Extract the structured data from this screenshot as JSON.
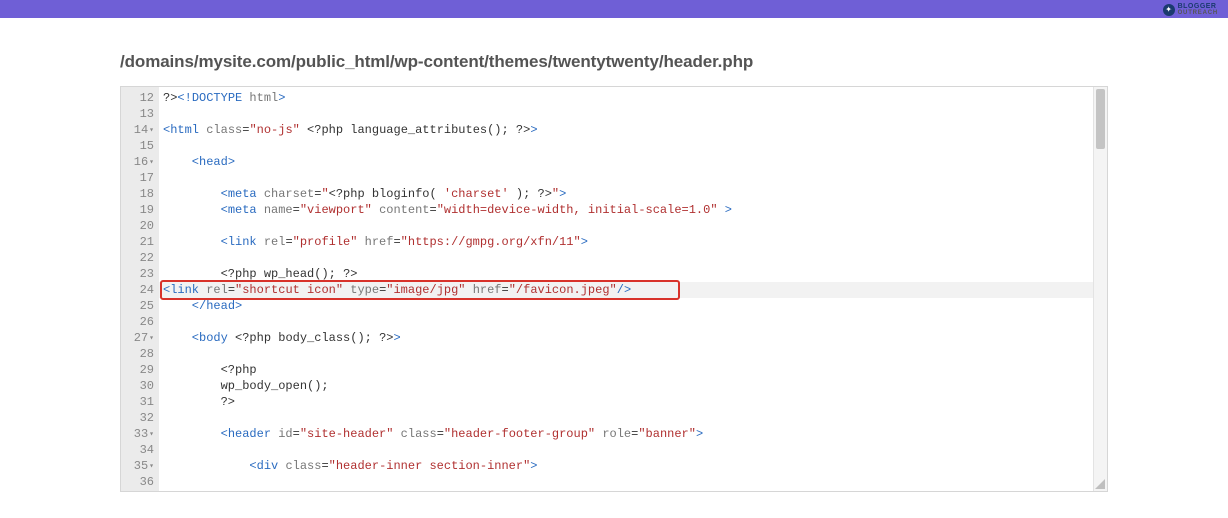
{
  "branding": {
    "line1": "BLOGGER",
    "line2": "OUTREACH",
    "badge": "✦"
  },
  "filepath": "/domains/mysite.com/public_html/wp-content/themes/twentytwenty/header.php",
  "gutter": [
    {
      "n": "12",
      "fold": false
    },
    {
      "n": "13",
      "fold": false
    },
    {
      "n": "14",
      "fold": true
    },
    {
      "n": "15",
      "fold": false
    },
    {
      "n": "16",
      "fold": true
    },
    {
      "n": "17",
      "fold": false
    },
    {
      "n": "18",
      "fold": false
    },
    {
      "n": "19",
      "fold": false
    },
    {
      "n": "20",
      "fold": false
    },
    {
      "n": "21",
      "fold": false
    },
    {
      "n": "22",
      "fold": false
    },
    {
      "n": "23",
      "fold": false
    },
    {
      "n": "24",
      "fold": false
    },
    {
      "n": "25",
      "fold": false
    },
    {
      "n": "26",
      "fold": false
    },
    {
      "n": "27",
      "fold": true
    },
    {
      "n": "28",
      "fold": false
    },
    {
      "n": "29",
      "fold": false
    },
    {
      "n": "30",
      "fold": false
    },
    {
      "n": "31",
      "fold": false
    },
    {
      "n": "32",
      "fold": false
    },
    {
      "n": "33",
      "fold": true
    },
    {
      "n": "34",
      "fold": false
    },
    {
      "n": "35",
      "fold": true
    },
    {
      "n": "36",
      "fold": false
    }
  ],
  "code": {
    "l12": {
      "a": "?>",
      "b": "<!",
      "c": "DOCTYPE ",
      "d": "html",
      "e": ">"
    },
    "l14": {
      "a": "<",
      "b": "html ",
      "c": "class",
      "d": "=",
      "e": "\"no-js\"",
      "f": " <?php ",
      "g": "language_attributes",
      "h": "(); ",
      "i": "?>",
      "j": ">"
    },
    "l16": {
      "a": "    <",
      "b": "head",
      "c": ">"
    },
    "l18": {
      "a": "        <",
      "b": "meta ",
      "c": "charset",
      "d": "=",
      "e": "\"",
      "f": "<?php ",
      "g": "bloginfo",
      "h": "( ",
      "i": "'charset'",
      "j": " ); ",
      "k": "?>",
      "l": "\"",
      "m": ">"
    },
    "l19": {
      "a": "        <",
      "b": "meta ",
      "c": "name",
      "d": "=",
      "e": "\"viewport\"",
      "f": " ",
      "g": "content",
      "h": "=",
      "i": "\"width=device-width, initial-scale=1.0\"",
      "j": " >"
    },
    "l21": {
      "a": "        <",
      "b": "link ",
      "c": "rel",
      "d": "=",
      "e": "\"profile\"",
      "f": " ",
      "g": "href",
      "h": "=",
      "i": "\"https://gmpg.org/xfn/11\"",
      "j": ">"
    },
    "l23": {
      "a": "        <?php ",
      "b": "wp_head",
      "c": "(); ",
      "d": "?>"
    },
    "l24": {
      "a": "<",
      "b": "link ",
      "c": "rel",
      "d": "=",
      "e": "\"shortcut icon\"",
      "f": " ",
      "g": "type",
      "h": "=",
      "i": "\"image/jpg\"",
      "j": " ",
      "k": "href",
      "l": "=",
      "m": "\"/favicon.jpeg\"",
      "n": "/>"
    },
    "l25": {
      "a": "    </",
      "b": "head",
      "c": ">"
    },
    "l27": {
      "a": "    <",
      "b": "body ",
      "c": "<?php ",
      "d": "body_class",
      "e": "(); ",
      "f": "?>",
      "g": ">"
    },
    "l29": {
      "a": "        <?php"
    },
    "l30": {
      "a": "        ",
      "b": "wp_body_open",
      "c": "();"
    },
    "l31": {
      "a": "        ?>"
    },
    "l33": {
      "a": "        <",
      "b": "header ",
      "c": "id",
      "d": "=",
      "e": "\"site-header\"",
      "f": " ",
      "g": "class",
      "h": "=",
      "i": "\"header-footer-group\"",
      "j": " ",
      "k": "role",
      "l": "=",
      "m": "\"banner\"",
      "n": ">"
    },
    "l35": {
      "a": "            <",
      "b": "div ",
      "c": "class",
      "d": "=",
      "e": "\"header-inner section-inner\"",
      "f": ">"
    }
  }
}
